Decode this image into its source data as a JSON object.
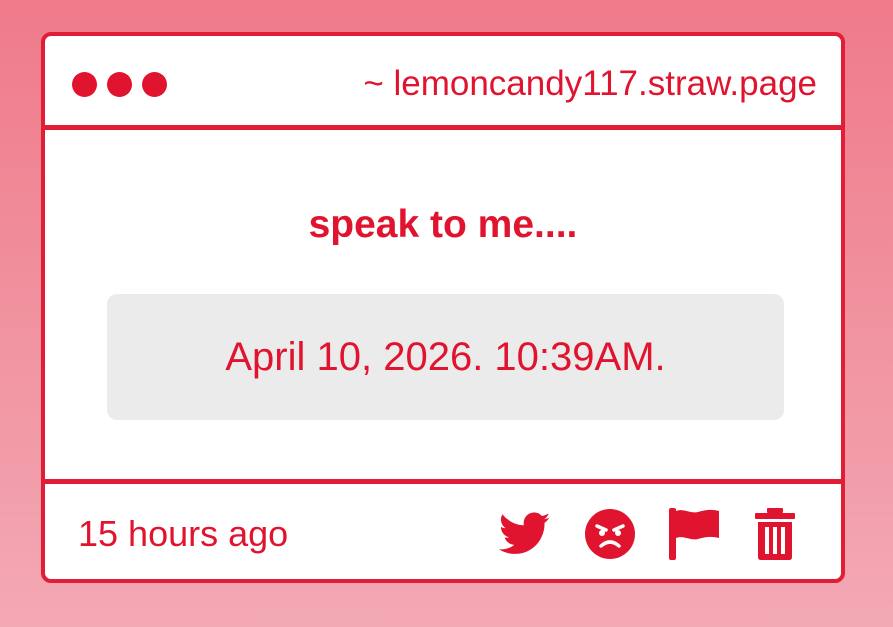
{
  "window": {
    "url": "~ lemoncandy117.straw.page"
  },
  "post": {
    "prompt": "speak to me....",
    "answer": "April 10, 2026. 10:39AM.",
    "time": "15 hours ago"
  },
  "icons": {
    "share": "twitter-bird-icon",
    "react": "angry-face-icon",
    "report": "flag-icon",
    "delete": "trash-icon"
  },
  "colors": {
    "accent": "#e0142e",
    "background_top": "#ef7a8a",
    "background_bottom": "#f3a9b4",
    "answer_box": "#ecebec"
  }
}
